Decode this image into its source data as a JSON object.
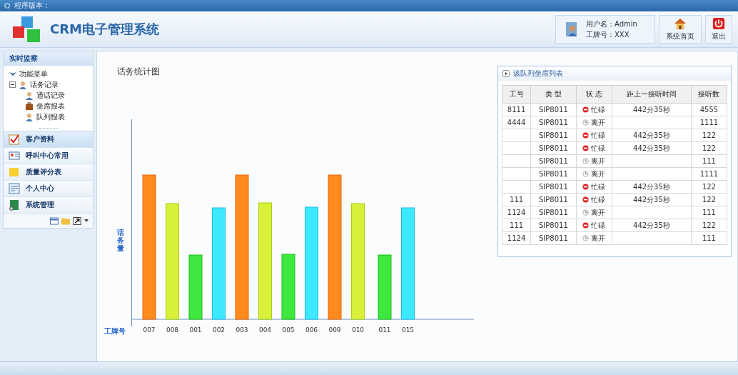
{
  "top_bar": {
    "title": "程序版本："
  },
  "header": {
    "app_title": "CRM电子管理系统",
    "user_name": "用户名：Admin",
    "badge_no": "工牌号：XXX",
    "buttons": [
      {
        "kind": "home",
        "label": "系统首页"
      },
      {
        "kind": "exit",
        "label": "退出"
      }
    ]
  },
  "sidebar": {
    "panel_title": "实时监察",
    "tree": [
      {
        "label": "功能菜单",
        "expanded": true,
        "children": [
          {
            "label": "话务记录",
            "expanded": true,
            "children": [
              {
                "label": "通话记录",
                "kind": "person"
              },
              {
                "label": "坐席报表",
                "kind": "case"
              },
              {
                "label": "队列报表",
                "kind": "person"
              }
            ]
          }
        ]
      }
    ],
    "items": [
      {
        "label": "客户资料",
        "kind": "check",
        "selected": true
      },
      {
        "label": "呼叫中心常用",
        "kind": "card",
        "selected": false
      },
      {
        "label": "质量评分表",
        "kind": "note",
        "selected": false
      },
      {
        "label": "个人中心",
        "kind": "form",
        "selected": false
      },
      {
        "label": "系统管理",
        "kind": "book",
        "selected": false
      }
    ]
  },
  "chart": {
    "title": "话务统计图",
    "ylabel": "话务量",
    "xlabel": "工牌号",
    "categories": [
      "007",
      "008",
      "001",
      "002",
      "003",
      "004",
      "005",
      "006",
      "009",
      "010",
      "011",
      "015"
    ]
  },
  "agent_table": {
    "title": "该队列坐席列表",
    "columns": [
      "工号",
      "类 型",
      "状 态",
      "距上一接听时间",
      "接听数"
    ],
    "rows": [
      {
        "id": "8111",
        "type": "SIP8011",
        "status": "忙碌",
        "busy": true,
        "since": "442分35秒",
        "count": "4555"
      },
      {
        "id": "4444",
        "type": "SIP8011",
        "status": "离开",
        "busy": false,
        "count": "1111"
      },
      {
        "type": "SIP8011",
        "status": "忙碌",
        "busy": true,
        "since": "442分35秒",
        "count": "122"
      },
      {
        "type": "SIP8011",
        "status": "忙碌",
        "busy": true,
        "since": "442分35秒",
        "count": "122"
      },
      {
        "type": "SIP8011",
        "status": "离开",
        "busy": false,
        "count": "111"
      },
      {
        "type": "SIP8011",
        "status": "离开",
        "busy": false,
        "count": "1111"
      },
      {
        "type": "SIP8011",
        "status": "忙碌",
        "busy": true,
        "since": "442分35秒",
        "count": "122"
      },
      {
        "id": "111",
        "type": "SIP8011",
        "status": "忙碌",
        "busy": true,
        "since": "442分35秒",
        "count": "122"
      },
      {
        "id": "1124",
        "type": "SIP8011",
        "status": "离开",
        "busy": false,
        "count": "111"
      },
      {
        "id": "111",
        "type": "SIP8011",
        "status": "忙碌",
        "busy": true,
        "since": "442分35秒",
        "count": "122"
      },
      {
        "id": "1124",
        "type": "SIP8011",
        "status": "离开",
        "busy": false,
        "count": "111"
      }
    ]
  }
}
